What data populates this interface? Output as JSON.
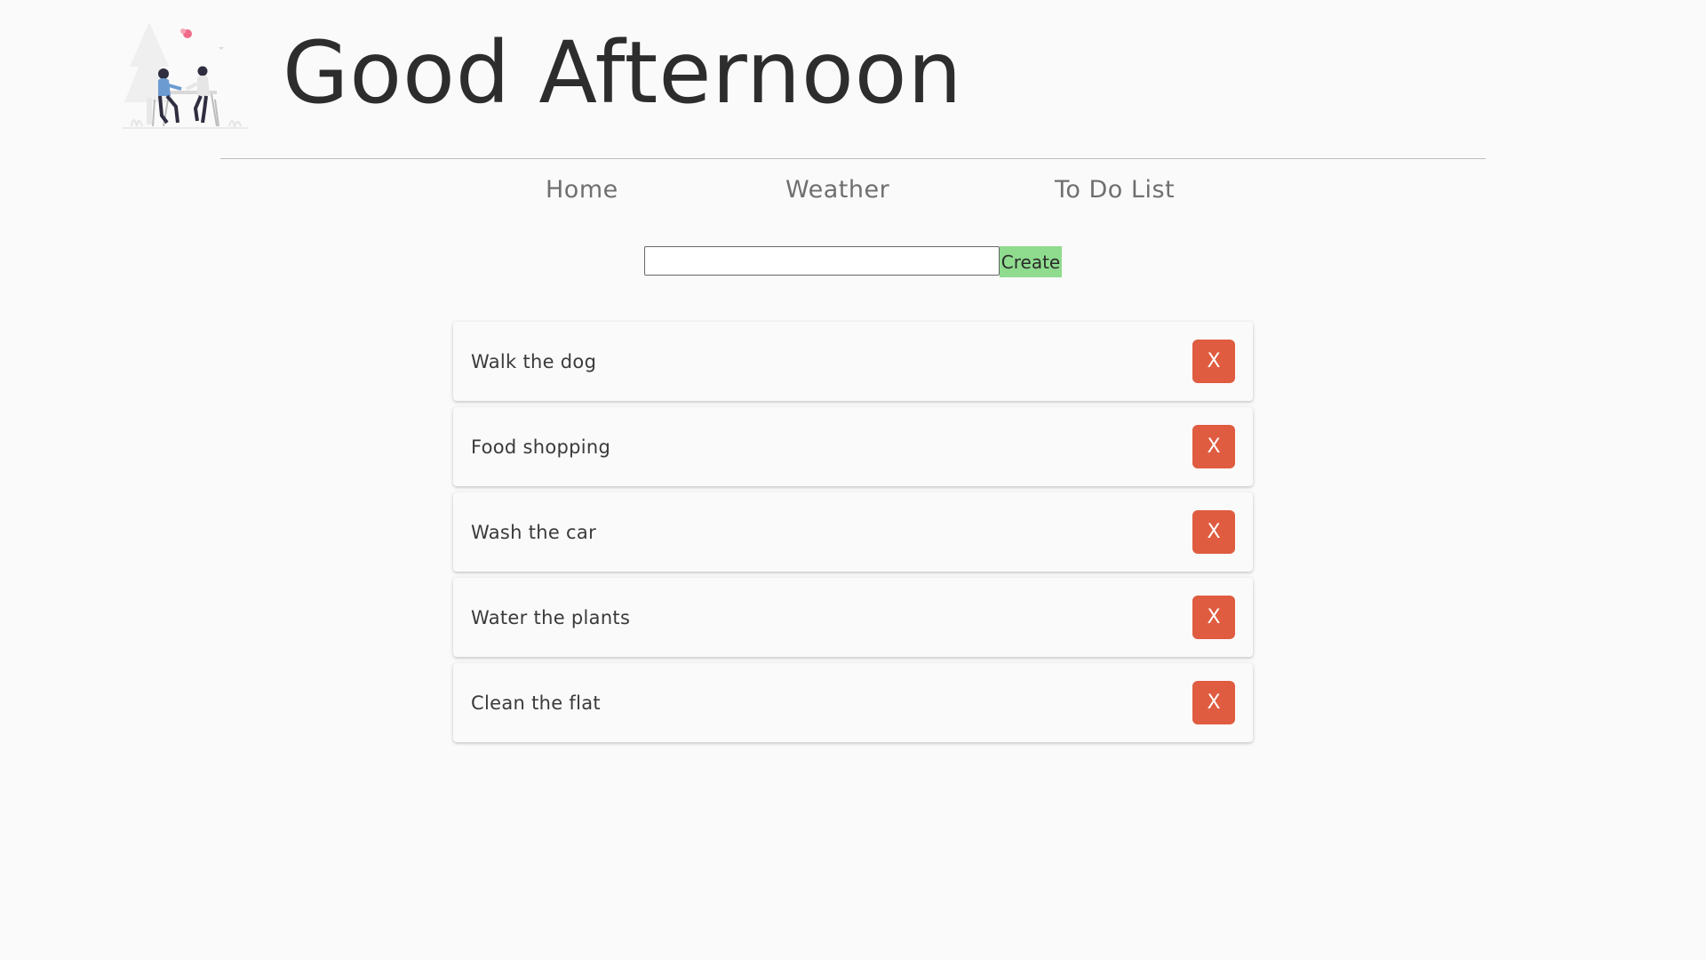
{
  "header": {
    "greeting": "Good Afternoon",
    "illustration_icon": "couple-at-table-illustration"
  },
  "nav": {
    "items": [
      {
        "label": "Home"
      },
      {
        "label": "Weather"
      },
      {
        "label": "To Do List"
      }
    ]
  },
  "create_form": {
    "input_value": "",
    "input_placeholder": "",
    "button_label": "Create"
  },
  "tasks": [
    {
      "text": "Walk the dog",
      "delete_label": "X"
    },
    {
      "text": "Food shopping",
      "delete_label": "X"
    },
    {
      "text": "Wash the car",
      "delete_label": "X"
    },
    {
      "text": "Water the plants",
      "delete_label": "X"
    },
    {
      "text": "Clean the flat",
      "delete_label": "X"
    }
  ],
  "colors": {
    "background": "#fafafa",
    "create_button": "#8fdc8f",
    "delete_button": "#e05c40",
    "nav_text": "#6f6f6f",
    "greeting_text": "#2d2d2d"
  }
}
